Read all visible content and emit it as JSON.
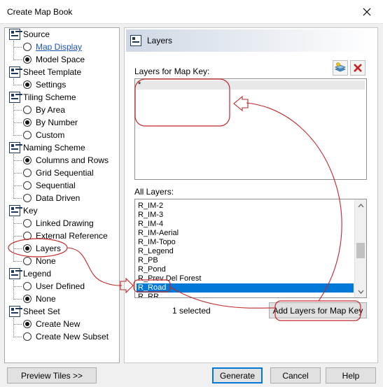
{
  "window": {
    "title": "Create Map Book"
  },
  "tree": {
    "groups": [
      {
        "label": "Source",
        "items": [
          {
            "label": "Map Display",
            "selected": false,
            "link": true
          },
          {
            "label": "Model Space",
            "selected": true
          }
        ]
      },
      {
        "label": "Sheet Template",
        "items": [
          {
            "label": "Settings",
            "selected": true
          }
        ]
      },
      {
        "label": "Tiling Scheme",
        "items": [
          {
            "label": "By Area",
            "selected": false
          },
          {
            "label": "By Number",
            "selected": true
          },
          {
            "label": "Custom",
            "selected": false
          }
        ]
      },
      {
        "label": "Naming Scheme",
        "items": [
          {
            "label": "Columns and Rows",
            "selected": true
          },
          {
            "label": "Grid Sequential",
            "selected": false
          },
          {
            "label": "Sequential",
            "selected": false
          },
          {
            "label": "Data Driven",
            "selected": false
          }
        ]
      },
      {
        "label": "Key",
        "items": [
          {
            "label": "Linked Drawing",
            "selected": false
          },
          {
            "label": "External Reference",
            "selected": false
          },
          {
            "label": "Layers",
            "selected": true
          },
          {
            "label": "None",
            "selected": false
          }
        ]
      },
      {
        "label": "Legend",
        "items": [
          {
            "label": "User Defined",
            "selected": false
          },
          {
            "label": "None",
            "selected": true
          }
        ]
      },
      {
        "label": "Sheet Set",
        "items": [
          {
            "label": "Create New",
            "selected": true
          },
          {
            "label": "Create New Subset",
            "selected": false
          }
        ]
      }
    ]
  },
  "panel": {
    "title": "Layers",
    "map_key_label": "Layers for Map Key:",
    "map_key_items": [
      "*"
    ],
    "all_layers_label": "All Layers:",
    "all_layers": [
      "R_IM-2",
      "R_IM-3",
      "R_IM-4",
      "R_IM-Aerial",
      "R_IM-Topo",
      "R_Legend",
      "R_PB",
      "R_Pond",
      "R_Prev Del Forest",
      "R_Road",
      "R_RR"
    ],
    "selected_layer": "R_Road",
    "selected_count": "1 selected",
    "add_button": "Add Layers for Map Key"
  },
  "buttons": {
    "preview": "Preview Tiles >>",
    "generate": "Generate",
    "cancel": "Cancel",
    "help": "Help"
  },
  "colors": {
    "selection": "#0078d7",
    "annotation": "#c0282a",
    "link": "#1a56b0"
  }
}
